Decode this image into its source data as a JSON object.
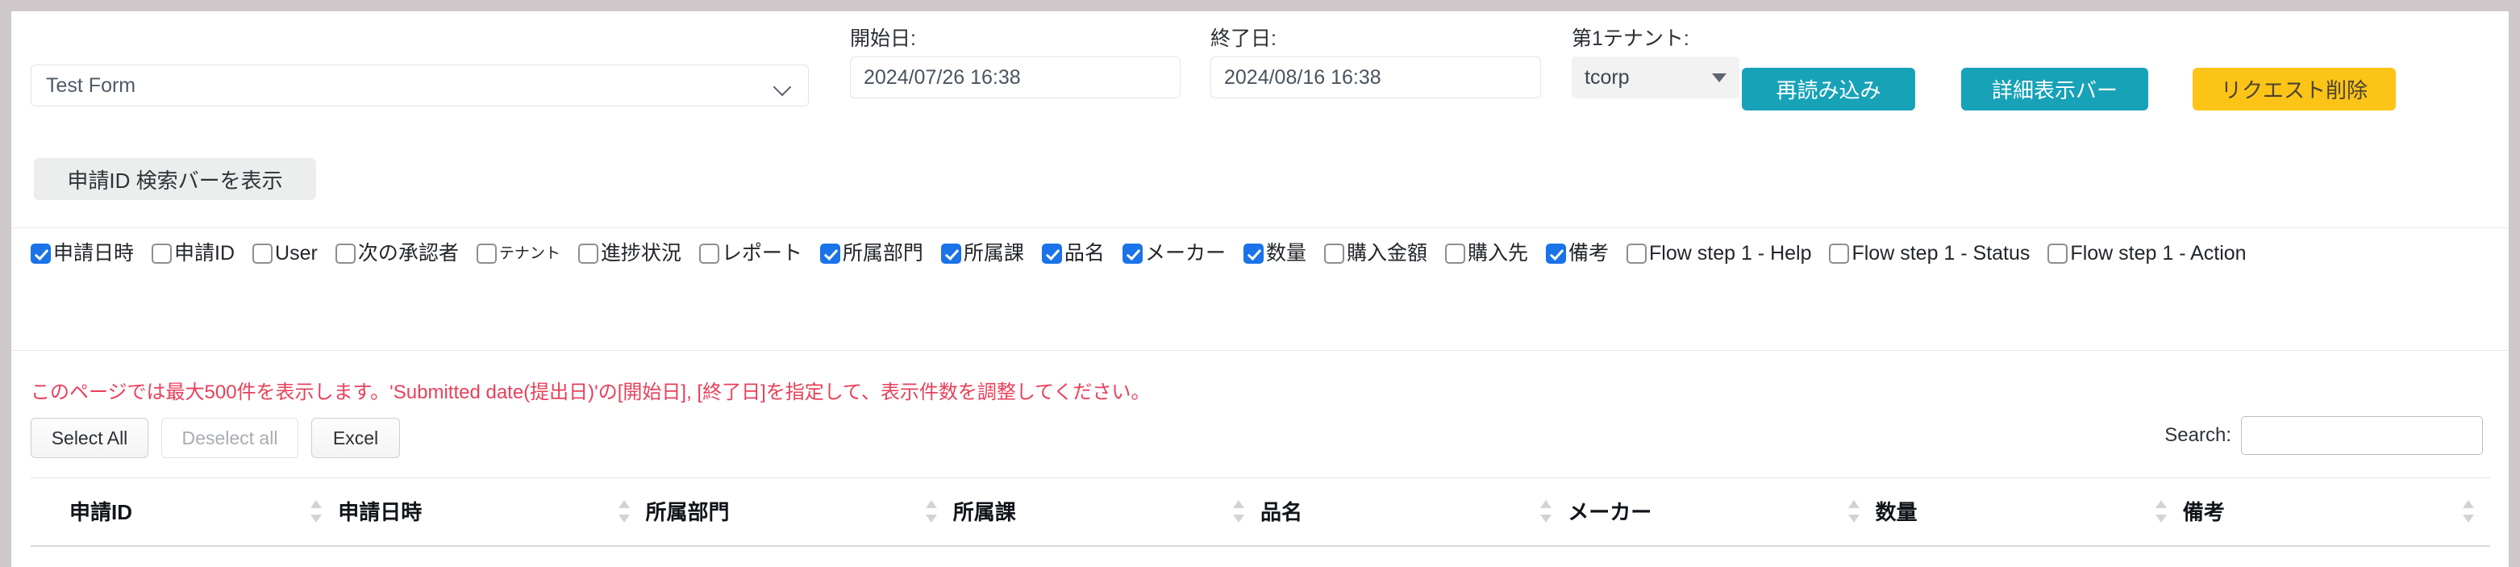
{
  "toolbar": {
    "form_select": {
      "value": "Test Form",
      "caret_icon": "chevron-down-icon"
    },
    "start_date": {
      "label": "開始日:",
      "value": "2024/07/26 16:38"
    },
    "end_date": {
      "label": "終了日:",
      "value": "2024/08/16 16:38"
    },
    "tenant": {
      "label": "第1テナント:",
      "value": "tcorp",
      "caret_icon": "triangle-down-icon"
    },
    "reload_button": "再読み込み",
    "detail_bar_button": "詳細表示バー",
    "delete_request_button": "リクエスト削除"
  },
  "search_bar_toggle": {
    "label": "申請ID 検索バーを表示"
  },
  "column_chooser": {
    "items": [
      {
        "label": "申請日時",
        "checked": true,
        "small": false
      },
      {
        "label": "申請ID",
        "checked": false,
        "small": false
      },
      {
        "label": "User",
        "checked": false,
        "small": false
      },
      {
        "label": "次の承認者",
        "checked": false,
        "small": false
      },
      {
        "label": "テナント",
        "checked": false,
        "small": true
      },
      {
        "label": "進捗状況",
        "checked": false,
        "small": false
      },
      {
        "label": "レポート",
        "checked": false,
        "small": false
      },
      {
        "label": "所属部門",
        "checked": true,
        "small": false
      },
      {
        "label": "所属課",
        "checked": true,
        "small": false
      },
      {
        "label": "品名",
        "checked": true,
        "small": false
      },
      {
        "label": "メーカー",
        "checked": true,
        "small": false
      },
      {
        "label": "数量",
        "checked": true,
        "small": false
      },
      {
        "label": "購入金額",
        "checked": false,
        "small": false
      },
      {
        "label": "購入先",
        "checked": false,
        "small": false
      },
      {
        "label": "備考",
        "checked": true,
        "small": false
      },
      {
        "label": "Flow step 1 - Help",
        "checked": false,
        "small": false
      },
      {
        "label": "Flow step 1 - Status",
        "checked": false,
        "small": false
      },
      {
        "label": "Flow step 1 - Action",
        "checked": false,
        "small": false
      }
    ]
  },
  "notice": {
    "text": "このページでは最大500件を表示します。'Submitted date(提出日)'の[開始日], [終了日]を指定して、表示件数を調整してください。",
    "color": "#e8405a"
  },
  "actions": {
    "select_all": "Select All",
    "deselect_all": "Deselect all",
    "excel": "Excel"
  },
  "search": {
    "label": "Search:",
    "value": "",
    "placeholder": ""
  },
  "table": {
    "columns": [
      {
        "label": "申請ID",
        "sortable": true
      },
      {
        "label": "申請日時",
        "sortable": true
      },
      {
        "label": "所属部門",
        "sortable": true
      },
      {
        "label": "所属課",
        "sortable": true
      },
      {
        "label": "品名",
        "sortable": true
      },
      {
        "label": "メーカー",
        "sortable": true
      },
      {
        "label": "数量",
        "sortable": true
      },
      {
        "label": "備考",
        "sortable": true
      }
    ],
    "rows": []
  },
  "colors": {
    "teal_button": "#17a2b8",
    "amber_button": "#fcc417",
    "checkbox_checked": "#1a73e8",
    "notice_red": "#e8405a",
    "page_border": "#cfc8ca"
  }
}
